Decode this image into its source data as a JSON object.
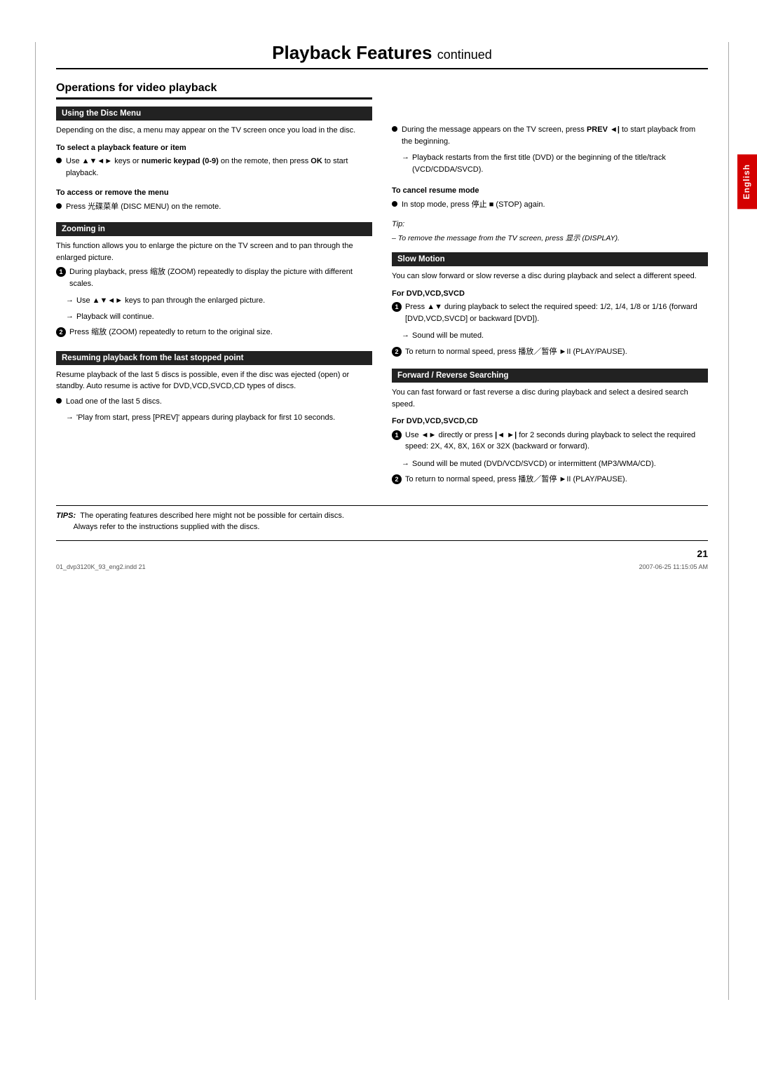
{
  "page": {
    "title": "Playback Features",
    "title_suffix": "continued",
    "side_tab": "English",
    "page_number": "21",
    "footer_file_left": "01_dvp3120K_93_eng2.indd  21",
    "footer_file_right": "2007-06-25   11:15:05 AM"
  },
  "operations_heading": "Operations for video playback",
  "left_col": {
    "section1_header": "Using the Disc Menu",
    "section1_body": "Depending on the disc, a menu may appear on the TV screen once you load in the disc.",
    "select_feature_heading": "To select a playback feature or item",
    "select_feature_bullet": "Use ▲▼◄► keys or numeric keypad (0-9) on the remote, then press OK to start playback.",
    "access_menu_heading": "To access or remove the menu",
    "access_menu_bullet": "Press 光碟菜单 (DISC MENU) on the remote.",
    "section2_header": "Zooming in",
    "section2_body": "This function allows you to enlarge the picture on the TV screen and to pan through the enlarged picture.",
    "zoom_step1": "During playback, press 缩放 (ZOOM) repeatedly to display the picture with different scales.",
    "zoom_arrow1": "Use ▲▼◄► keys to pan through the enlarged picture.",
    "zoom_arrow2": "Playback will continue.",
    "zoom_step2": "Press 缩放 (ZOOM) repeatedly to return to the original size.",
    "section3_header": "Resuming playback from the last stopped point",
    "resume_body": "Resume playback of the last 5 discs is possible, even if the disc was ejected (open) or standby. Auto resume is active for DVD,VCD,SVCD,CD types of discs.",
    "load_bullet": "Load one of the last 5 discs.",
    "load_arrow": "'Play from start, press [PREV]' appears during playback for first 10 seconds."
  },
  "right_col": {
    "resume_body2_bullet": "During the message appears on the TV screen, press PREV ◄| to start playback from the beginning.",
    "resume_arrow1": "Playback restarts from the first title (DVD) or the beginning of the title/track (VCD/CDDA/SVCD).",
    "cancel_resume_heading": "To cancel resume mode",
    "cancel_resume_bullet": "In stop mode, press 停止 ■ (STOP) again.",
    "tip_label": "Tip:",
    "tip_text": "– To remove the message from the TV screen, press 显示 (DISPLAY).",
    "section_slow_header": "Slow Motion",
    "slow_body": "You can slow forward or slow reverse a disc during playback and select a different speed.",
    "dvd_vcd_svcd_heading": "For DVD,VCD,SVCD",
    "dvd_step1": "Press ▲▼ during playback to select the required speed: 1/2, 1/4, 1/8 or 1/16 (forward [DVD,VCD,SVCD] or backward [DVD]).",
    "dvd_arrow1": "Sound will be muted.",
    "dvd_step2": "To return to normal speed, press 播放／暂停 ►II (PLAY/PAUSE).",
    "section_forward_header": "Forward / Reverse Searching",
    "forward_body": "You can fast forward or fast reverse a disc during playback and select a desired search speed.",
    "dvdcd_heading": "For DVD,VCD,SVCD,CD",
    "fwd_step1": "Use ◄► directly or press |◄ ►| for 2 seconds during playback to select the required speed: 2X, 4X, 8X, 16X or 32X (backward or forward).",
    "fwd_arrow1": "Sound will be muted (DVD/VCD/SVCD) or intermittent (MP3/WMA/CD).",
    "fwd_step2": "To return to normal speed, press 播放／暂停 ►II (PLAY/PAUSE)."
  },
  "footer": {
    "tips_bold": "TIPS:",
    "tips_text1": "The operating features described here might not be possible for certain discs.",
    "tips_text2": "Always refer to the instructions supplied with the discs."
  }
}
